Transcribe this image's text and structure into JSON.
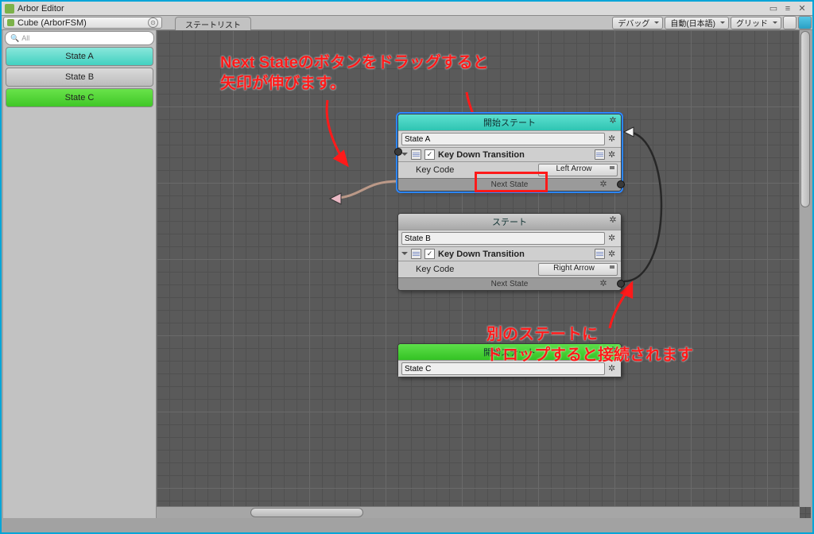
{
  "window": {
    "title": "Arbor Editor"
  },
  "toolbar": {
    "object": "Cube (ArborFSM)",
    "tab": "ステートリスト",
    "debug": "デバッグ",
    "lang": "自動(日本語)",
    "grid": "グリッド"
  },
  "sidebar": {
    "search_placeholder": "All",
    "items": [
      {
        "label": "State A",
        "style": "teal"
      },
      {
        "label": "State B",
        "style": "gray"
      },
      {
        "label": "State C",
        "style": "green"
      }
    ]
  },
  "nodes": {
    "a": {
      "header": "開始ステート",
      "name": "State A",
      "behaviour": "Key Down Transition",
      "param": "Key Code",
      "value": "Left Arrow",
      "next": "Next State"
    },
    "b": {
      "header": "ステート",
      "name": "State B",
      "behaviour": "Key Down Transition",
      "param": "Key Code",
      "value": "Right Arrow",
      "next": "Next State"
    },
    "c": {
      "header": "開始ステート",
      "name": "State C"
    }
  },
  "annotations": {
    "t1a": "Next Stateのボタンをドラッグすると",
    "t1b": "矢印が伸びます。",
    "t2a": "別のステートに",
    "t2b": "ドロップすると接続されます"
  }
}
